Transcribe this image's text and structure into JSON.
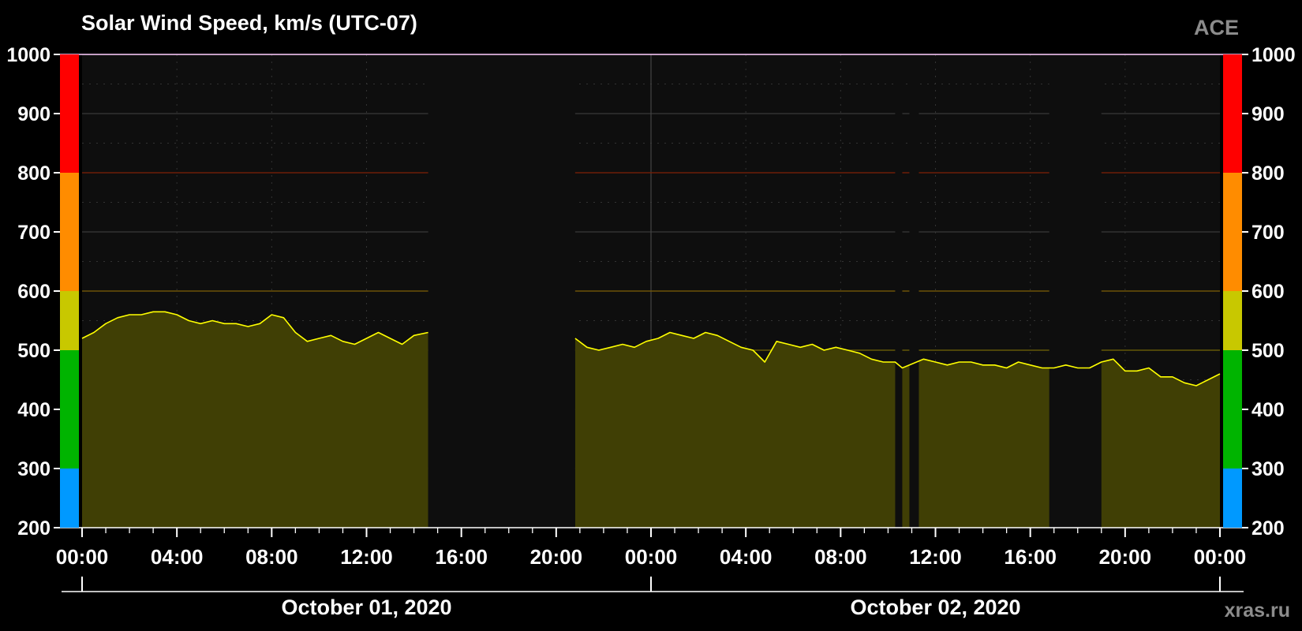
{
  "chart_data": {
    "type": "area",
    "title": "Solar Wind Speed, km/s (UTC-07)",
    "source_label": "ACE",
    "watermark": "xras.ru",
    "ylim": [
      200,
      1000
    ],
    "yticks": [
      "200",
      "300",
      "400",
      "500",
      "600",
      "700",
      "800",
      "900",
      "1000"
    ],
    "xlim_hours": [
      0,
      48
    ],
    "xticks": [
      "00:00",
      "04:00",
      "08:00",
      "12:00",
      "16:00",
      "20:00",
      "00:00",
      "04:00",
      "08:00",
      "12:00",
      "16:00",
      "20:00",
      "00:00"
    ],
    "dates": [
      "October 01, 2020",
      "October 02, 2020"
    ],
    "grid": true,
    "thresholds": [
      500,
      600,
      800
    ],
    "scale_bands": [
      {
        "from": 200,
        "to": 300,
        "color": "#0099ff"
      },
      {
        "from": 300,
        "to": 500,
        "color": "#00b400"
      },
      {
        "from": 500,
        "to": 600,
        "color": "#c8c800"
      },
      {
        "from": 600,
        "to": 800,
        "color": "#ff8c00"
      },
      {
        "from": 800,
        "to": 1000,
        "color": "#ff0000"
      }
    ],
    "colors": {
      "line": "#ffff00",
      "fill": "#403f05",
      "plot_bg": "#0e0e0e",
      "frame": "#ffccff"
    },
    "series": [
      {
        "segments": [
          {
            "x": [
              0.0,
              0.5,
              1.0,
              1.5,
              2.0,
              2.5,
              3.0,
              3.5,
              4.0,
              4.5,
              5.0,
              5.5,
              6.0,
              6.5,
              7.0,
              7.5,
              8.0,
              8.5,
              9.0,
              9.5,
              10.0,
              10.5,
              11.0,
              11.5,
              12.0,
              12.5,
              13.0,
              13.5,
              14.0,
              14.6
            ],
            "y": [
              520,
              530,
              545,
              555,
              560,
              560,
              565,
              565,
              560,
              550,
              545,
              550,
              545,
              545,
              540,
              545,
              560,
              555,
              530,
              515,
              520,
              525,
              515,
              510,
              520,
              530,
              520,
              510,
              525,
              530
            ]
          },
          {
            "x": [
              20.8,
              21.3,
              21.8,
              22.3,
              22.8,
              23.3,
              23.8,
              24.3,
              24.8,
              25.3,
              25.8,
              26.3,
              26.8,
              27.3,
              27.8,
              28.3,
              28.8,
              29.3,
              29.8,
              30.3,
              30.8,
              31.3,
              31.8,
              32.3,
              32.8,
              33.3,
              33.8,
              34.3,
              34.6,
              34.9,
              35.5,
              36.0,
              36.5,
              37.0,
              37.5,
              38.0,
              38.5,
              39.0,
              39.5,
              40.0,
              40.5,
              41.0,
              41.5,
              42.0,
              42.5,
              43.0,
              43.5,
              44.0,
              44.5,
              45.0,
              45.5,
              46.0,
              46.5,
              47.0,
              47.5,
              48.0
            ],
            "y": [
              520,
              505,
              500,
              505,
              510,
              505,
              515,
              520,
              530,
              525,
              520,
              530,
              525,
              515,
              505,
              500,
              480,
              515,
              510,
              505,
              510,
              500,
              505,
              500,
              495,
              485,
              480,
              480,
              470,
              475,
              485,
              480,
              475,
              480,
              480,
              475,
              475,
              470,
              480,
              475,
              470,
              470,
              475,
              470,
              470,
              480,
              485,
              465,
              465,
              470,
              455,
              455,
              445,
              440,
              450,
              460
            ]
          }
        ],
        "gaps": [
          [
            14.6,
            20.8
          ],
          [
            34.3,
            34.6
          ],
          [
            34.9,
            35.3
          ],
          [
            40.8,
            43.0
          ]
        ]
      }
    ]
  }
}
